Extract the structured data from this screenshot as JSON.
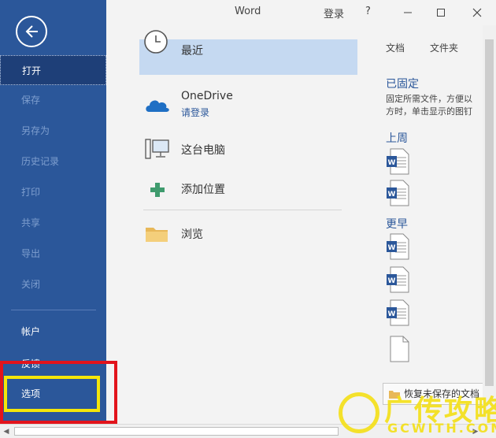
{
  "titlebar": {
    "title": "Word",
    "signin": "登录",
    "help": "?"
  },
  "sidebar": {
    "items": [
      {
        "label": "打开"
      },
      {
        "label": "保存"
      },
      {
        "label": "另存为"
      },
      {
        "label": "历史记录"
      },
      {
        "label": "打印"
      },
      {
        "label": "共享"
      },
      {
        "label": "导出"
      },
      {
        "label": "关闭"
      },
      {
        "label": "帐户"
      },
      {
        "label": "反馈"
      },
      {
        "label": "选项"
      }
    ]
  },
  "places": {
    "recent": "最近",
    "onedrive": "OneDrive",
    "onedrive_sub": "请登录",
    "this_pc": "这台电脑",
    "add_place": "添加位置",
    "browse": "浏览"
  },
  "right": {
    "tabs": [
      "文档",
      "文件夹"
    ],
    "pinned_title": "已固定",
    "pinned_desc_1": "固定所需文件，方便以",
    "pinned_desc_2": "方时，单击显示的图钉",
    "last_week": "上周",
    "earlier": "更早",
    "recover": "恢复未保存的文档"
  },
  "watermark": {
    "main": "广传攻略",
    "sub": "GCWITH.COM"
  },
  "colors": {
    "sidebar": "#2b579a",
    "accent": "#2b579a",
    "annotation_red": "#e2141c",
    "annotation_yellow": "#f4e60a"
  }
}
